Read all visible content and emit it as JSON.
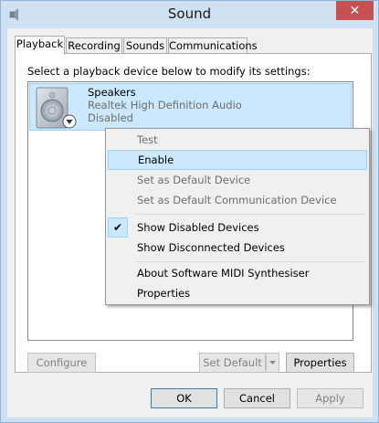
{
  "window": {
    "title": "Sound",
    "close_glyph": "✕"
  },
  "tabs": [
    {
      "label": "Playback",
      "active": true
    },
    {
      "label": "Recording",
      "active": false
    },
    {
      "label": "Sounds",
      "active": false
    },
    {
      "label": "Communications",
      "active": false
    }
  ],
  "playback": {
    "instruction": "Select a playback device below to modify its settings:",
    "device": {
      "name": "Speakers",
      "description": "Realtek High Definition Audio",
      "status": "Disabled"
    },
    "configure_label": "Configure",
    "set_default_label": "Set Default",
    "properties_label": "Properties"
  },
  "context_menu": {
    "items": [
      {
        "label": "Test",
        "state": "disabled"
      },
      {
        "label": "Enable",
        "state": "highlight"
      },
      {
        "label": "Set as Default Device",
        "state": "disabled"
      },
      {
        "label": "Set as Default Communication Device",
        "state": "disabled"
      },
      {
        "label": "Show Disabled Devices",
        "state": "checked"
      },
      {
        "label": "Show Disconnected Devices",
        "state": "normal"
      },
      {
        "label": "About Software MIDI Synthesiser",
        "state": "normal"
      },
      {
        "label": "Properties",
        "state": "normal"
      }
    ],
    "check_glyph": "✔"
  },
  "dialog_buttons": {
    "ok": "OK",
    "cancel": "Cancel",
    "apply": "Apply"
  },
  "colors": {
    "titlebar": "#cfe0f2",
    "close": "#c75050",
    "selection": "#cce8ff",
    "selection_border": "#99d1ff"
  }
}
